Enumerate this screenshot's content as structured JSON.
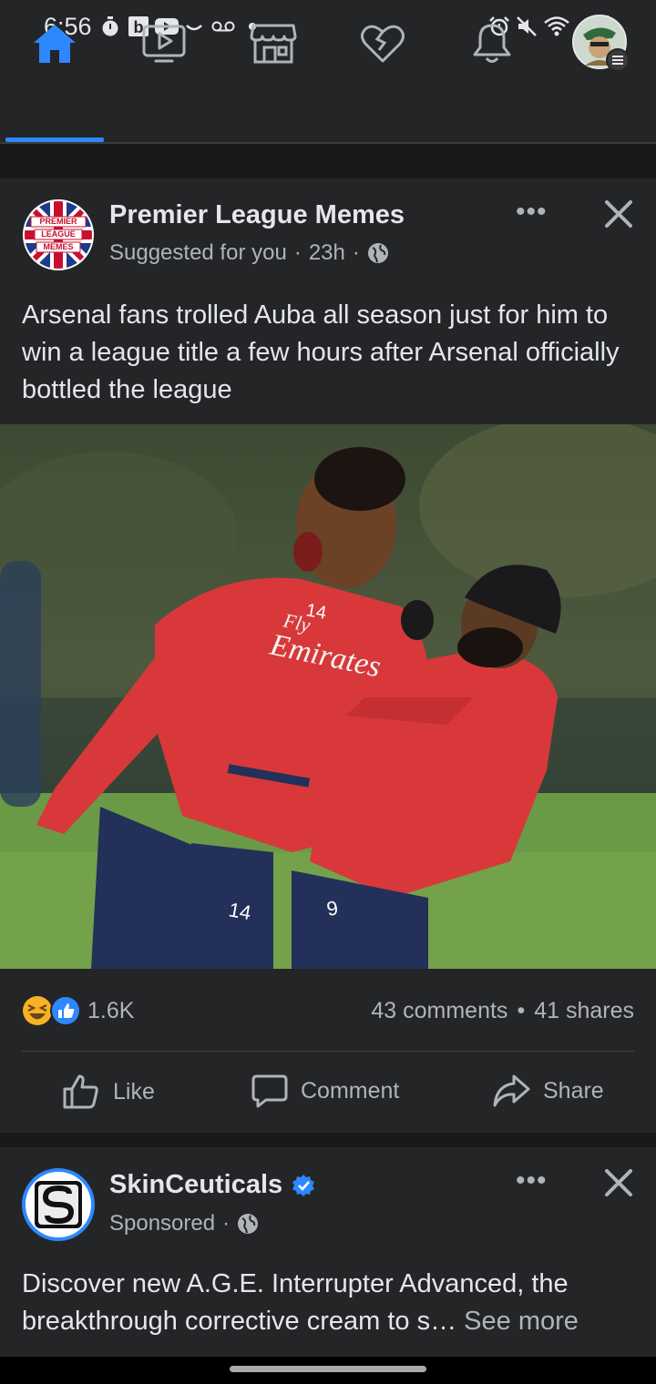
{
  "status_bar": {
    "time": "6:56",
    "left_icons": [
      "stopwatch-icon",
      "b-app-icon",
      "youtube-icon",
      "amazon-smile-icon",
      "voicemail-icon",
      "dot-icon"
    ],
    "right_icons": [
      "alarm-icon",
      "mute-icon",
      "wifi-icon",
      "signal-icon",
      "battery-icon"
    ]
  },
  "nav": {
    "active": "home",
    "items": [
      "home-icon",
      "watch-icon",
      "marketplace-icon",
      "dating-icon",
      "notifications-icon",
      "profile-menu-icon"
    ]
  },
  "colors": {
    "accent": "#2d88ff",
    "bg": "#18191a",
    "card": "#242526",
    "text": "#e4e6eb",
    "secondary": "#b0b3b8"
  },
  "post1": {
    "avatar_text": [
      "PREMIER",
      "LEAGUE",
      "MEMES"
    ],
    "page_name": "Premier League Memes",
    "suggested": "Suggested for you",
    "time": "23h",
    "text": "Arsenal fans trolled Auba all season just for him to win a league title a few hours after Arsenal officially bottled the league",
    "image": {
      "shirt_sponsor": [
        "Fly",
        "Emirates"
      ],
      "numbers": [
        "14",
        "9"
      ]
    },
    "reactions_count": "1.6K",
    "comments": "43 comments",
    "shares": "41 shares",
    "actions": {
      "like": "Like",
      "comment": "Comment",
      "share": "Share"
    }
  },
  "post2": {
    "page_name": "SkinCeuticals",
    "sponsored": "Sponsored",
    "text": "Discover new A.G.E. Interrupter Advanced, the breakthrough corrective cream to s…",
    "see_more": "See more"
  }
}
